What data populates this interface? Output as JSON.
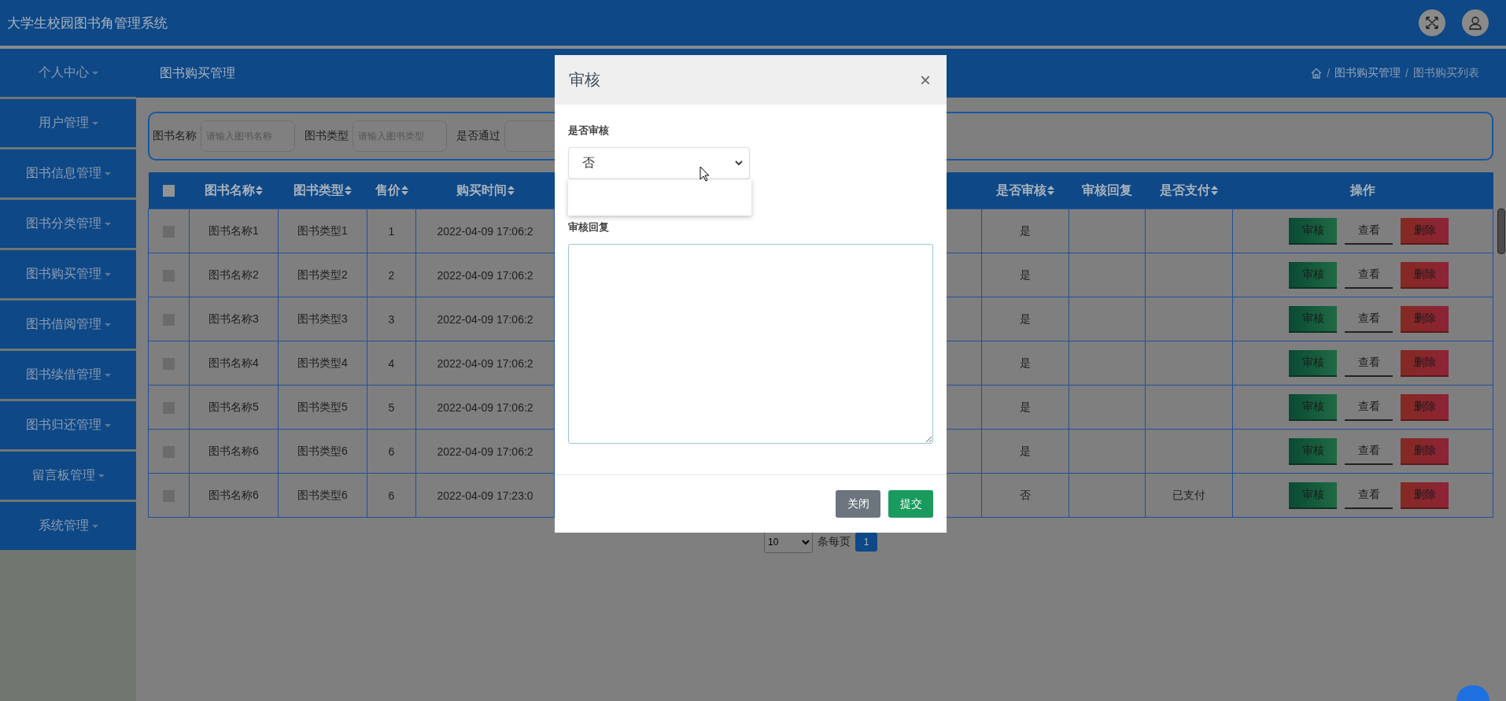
{
  "header": {
    "title": "大学生校园图书角管理系统"
  },
  "sidebar": {
    "items": [
      {
        "label": "个人中心"
      },
      {
        "label": "用户管理"
      },
      {
        "label": "图书信息管理"
      },
      {
        "label": "图书分类管理"
      },
      {
        "label": "图书购买管理"
      },
      {
        "label": "图书借阅管理"
      },
      {
        "label": "图书续借管理"
      },
      {
        "label": "图书归还管理"
      },
      {
        "label": "留言板管理"
      },
      {
        "label": "系统管理"
      }
    ]
  },
  "page": {
    "title": "图书购买管理",
    "breadcrumb": [
      {
        "kind": "separator",
        "text": "/"
      },
      {
        "kind": "link",
        "text": "图书购买管理"
      },
      {
        "kind": "separator",
        "text": "/"
      },
      {
        "kind": "current",
        "text": "图书购买列表"
      }
    ]
  },
  "search": [
    {
      "label": "图书名称",
      "placeholder": "请输入图书名称"
    },
    {
      "label": "图书类型",
      "placeholder": "请输入图书类型"
    },
    {
      "label": "是否通过"
    }
  ],
  "table": {
    "columns": [
      {
        "kind": "checkbox",
        "checked": false
      },
      {
        "kind": "text",
        "label": "图书名称",
        "sortable": true
      },
      {
        "kind": "text",
        "label": "图书类型",
        "sortable": true
      },
      {
        "kind": "text",
        "label": "售价",
        "sortable": true
      },
      {
        "kind": "text",
        "label": "购买时间",
        "sortable": true
      },
      {
        "kind": "covered"
      },
      {
        "kind": "text",
        "label": "是否审核",
        "sortable": true
      },
      {
        "kind": "text",
        "label": "审核回复",
        "sortable": false
      },
      {
        "kind": "text",
        "label": "是否支付",
        "sortable": true
      },
      {
        "kind": "actions",
        "label": "操作"
      }
    ],
    "rows": [
      {
        "checked": false,
        "cells": [
          "",
          "图书名称1",
          "图书类型1",
          "1",
          "2022-04-09 17:06:2",
          "",
          "是",
          "",
          "",
          ""
        ],
        "actions": [
          {
            "label": "审核",
            "kind": "review"
          },
          {
            "label": "查看",
            "kind": "view"
          },
          {
            "label": "删除",
            "kind": "delete"
          }
        ]
      },
      {
        "checked": false,
        "cells": [
          "",
          "图书名称2",
          "图书类型2",
          "2",
          "2022-04-09 17:06:2",
          "",
          "是",
          "",
          "",
          ""
        ],
        "actions": [
          {
            "label": "审核",
            "kind": "review"
          },
          {
            "label": "查看",
            "kind": "view"
          },
          {
            "label": "删除",
            "kind": "delete"
          }
        ]
      },
      {
        "checked": false,
        "cells": [
          "",
          "图书名称3",
          "图书类型3",
          "3",
          "2022-04-09 17:06:2",
          "",
          "是",
          "",
          "",
          ""
        ],
        "actions": [
          {
            "label": "审核",
            "kind": "review"
          },
          {
            "label": "查看",
            "kind": "view"
          },
          {
            "label": "删除",
            "kind": "delete"
          }
        ]
      },
      {
        "checked": false,
        "cells": [
          "",
          "图书名称4",
          "图书类型4",
          "4",
          "2022-04-09 17:06:2",
          "",
          "是",
          "",
          "",
          ""
        ],
        "actions": [
          {
            "label": "审核",
            "kind": "review"
          },
          {
            "label": "查看",
            "kind": "view"
          },
          {
            "label": "删除",
            "kind": "delete"
          }
        ]
      },
      {
        "checked": false,
        "cells": [
          "",
          "图书名称5",
          "图书类型5",
          "5",
          "2022-04-09 17:06:2",
          "",
          "是",
          "",
          "",
          ""
        ],
        "actions": [
          {
            "label": "审核",
            "kind": "review"
          },
          {
            "label": "查看",
            "kind": "view"
          },
          {
            "label": "删除",
            "kind": "delete"
          }
        ]
      },
      {
        "checked": false,
        "cells": [
          "",
          "图书名称6",
          "图书类型6",
          "6",
          "2022-04-09 17:06:2",
          "",
          "是",
          "",
          "",
          ""
        ],
        "actions": [
          {
            "label": "审核",
            "kind": "review"
          },
          {
            "label": "查看",
            "kind": "view"
          },
          {
            "label": "删除",
            "kind": "delete"
          }
        ]
      },
      {
        "checked": false,
        "cells": [
          "",
          "图书名称6",
          "图书类型6",
          "6",
          "2022-04-09 17:23:0",
          "",
          "否",
          "",
          "已支付",
          ""
        ],
        "actions": [
          {
            "label": "审核",
            "kind": "review"
          },
          {
            "label": "查看",
            "kind": "view"
          },
          {
            "label": "删除",
            "kind": "delete"
          }
        ]
      }
    ]
  },
  "pagination": {
    "page_size": "10",
    "per_page_label": "条每页",
    "pages": [
      {
        "label": "1",
        "selected": true
      }
    ]
  },
  "modal": {
    "title": "审核",
    "close": "×",
    "fields": [
      {
        "kind": "select",
        "label": "是否审核",
        "value": "否",
        "expanded": true
      },
      {
        "kind": "textarea",
        "label": "审核回复"
      }
    ],
    "buttons": [
      {
        "label": "关闭",
        "kind": "secondary"
      },
      {
        "label": "提交",
        "kind": "primary"
      }
    ]
  }
}
